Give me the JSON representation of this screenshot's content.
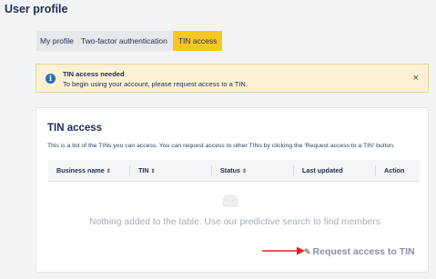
{
  "header": {
    "title": "User profile"
  },
  "tabs": [
    {
      "label": "My profile"
    },
    {
      "label": "Two-factor authentication"
    },
    {
      "label": "TIN access"
    }
  ],
  "alert": {
    "icon": "info-icon",
    "title": "TIN access needed",
    "message": "To begin using your account, please request access to a TIN.",
    "close_label": "×"
  },
  "card": {
    "title": "TIN access",
    "description": "This is a list of the TINs you can access. You can request access to other TINs by clicking the 'Request access to a TIN' button.",
    "table": {
      "columns": [
        "Business name",
        "TIN",
        "Status",
        "Last updated",
        "Action"
      ],
      "sort_glyph": "⇕"
    },
    "empty_text": "Nothing added to the table. Use our predictive search to find members",
    "request_button": {
      "icon": "pencil-icon",
      "label": "Request access to TIN"
    }
  },
  "colors": {
    "active_tab": "#f7c823",
    "alert_bg": "#fcf1d6",
    "info_icon": "#2a6fbe",
    "annotation_arrow": "#e0251b"
  }
}
